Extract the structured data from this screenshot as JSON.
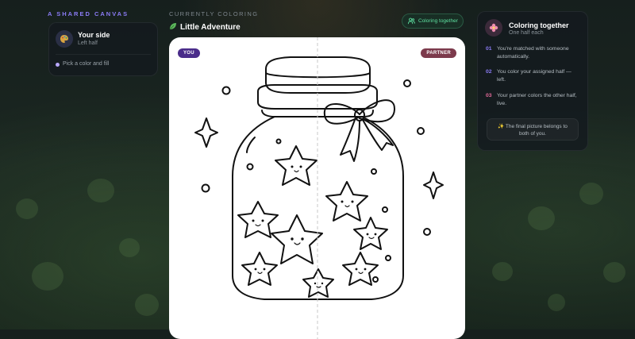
{
  "left_panel": {
    "kicker": "A SHARED CANVAS",
    "side_title": "Your side",
    "side_subtitle": "Left half",
    "hint": "Pick a color and fill",
    "avatar_icon": "palette-icon"
  },
  "header": {
    "kicker": "CURRENTLY COLORING",
    "title": "Little Adventure",
    "title_icon": "leaf-icon",
    "status_chip": "Coloring together",
    "status_icon": "users-icon"
  },
  "canvas": {
    "you_label": "YOU",
    "partner_label": "PARTNER",
    "you_color": "#4a2c8a",
    "partner_color": "#7c3a4c"
  },
  "right_panel": {
    "title": "Coloring together",
    "subtitle": "One half each",
    "avatar_icon": "flower-icon",
    "steps": [
      {
        "num": "01",
        "text": "You're matched with someone automatically."
      },
      {
        "num": "02",
        "text": "You color your assigned half — left."
      },
      {
        "num": "03",
        "text": "Your partner colors the other half, live."
      }
    ],
    "footer_note": "The final picture belongs to both of you.",
    "footer_icon": "sparkle-icon"
  },
  "colors": {
    "accent_purple": "#8b7cf6",
    "accent_green": "#5ee0a0",
    "step_colors": [
      "#8b7cf6",
      "#8b7cf6",
      "#e46a9a"
    ]
  }
}
